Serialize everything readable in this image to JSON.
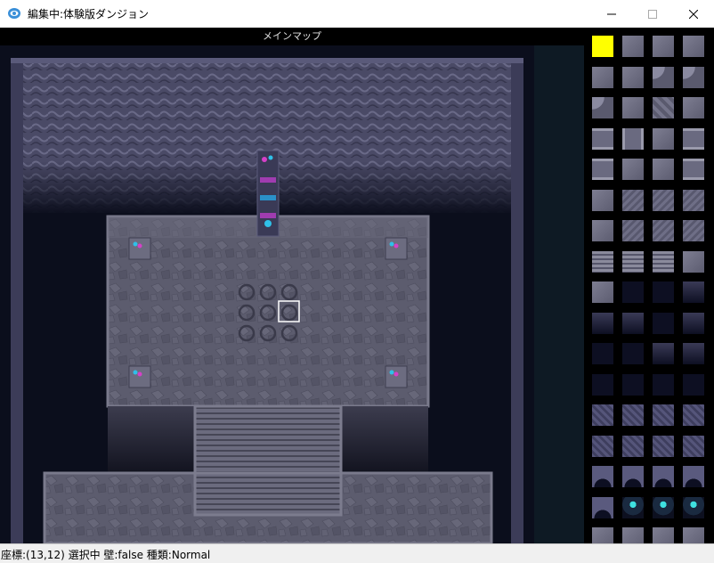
{
  "window": {
    "title": "編集中:体験版ダンジョン",
    "minimize_label": "─",
    "maximize_label": "☐",
    "close_label": "✕"
  },
  "map": {
    "header": "メインマップ",
    "selected_cell": "(13,12)"
  },
  "palette": {
    "columns": 4,
    "selected_index": 0,
    "selected_color": "#ffff00",
    "tiles": [
      "yellow",
      "stone",
      "stone",
      "stone",
      "stone",
      "stone",
      "corner",
      "corner",
      "corner",
      "stone",
      "stone-diag",
      "stone",
      "wall-h",
      "wall-v",
      "stone",
      "wall-h",
      "wall-h",
      "stone",
      "stone",
      "wall-h",
      "stone",
      "stone-rough",
      "stone-rough",
      "stone-rough",
      "stone",
      "stone-rough",
      "stone-rough",
      "stone-rough",
      "stairs",
      "stairs",
      "stairs",
      "stone",
      "stone",
      "dark",
      "dark",
      "dark-edge",
      "dark-edge",
      "dark-edge",
      "dark",
      "dark-edge",
      "dark",
      "dark",
      "dark-edge",
      "dark-edge",
      "dark",
      "dark",
      "dark",
      "dark",
      "rock",
      "rock",
      "rock",
      "rock",
      "rock",
      "rock",
      "rock",
      "rock",
      "rock-edge",
      "rock-edge",
      "rock-edge",
      "rock-edge",
      "rock-edge",
      "crystal",
      "crystal",
      "crystal",
      "stone",
      "stone",
      "stone",
      "stone"
    ]
  },
  "status": {
    "text": "座標:(13,12) 選択中 壁:false 種類:Normal"
  },
  "colors": {
    "floor": "#5a5a6c",
    "wall": "#4a4a62",
    "void": "#0b0e1c",
    "accent": "#ffff00"
  }
}
